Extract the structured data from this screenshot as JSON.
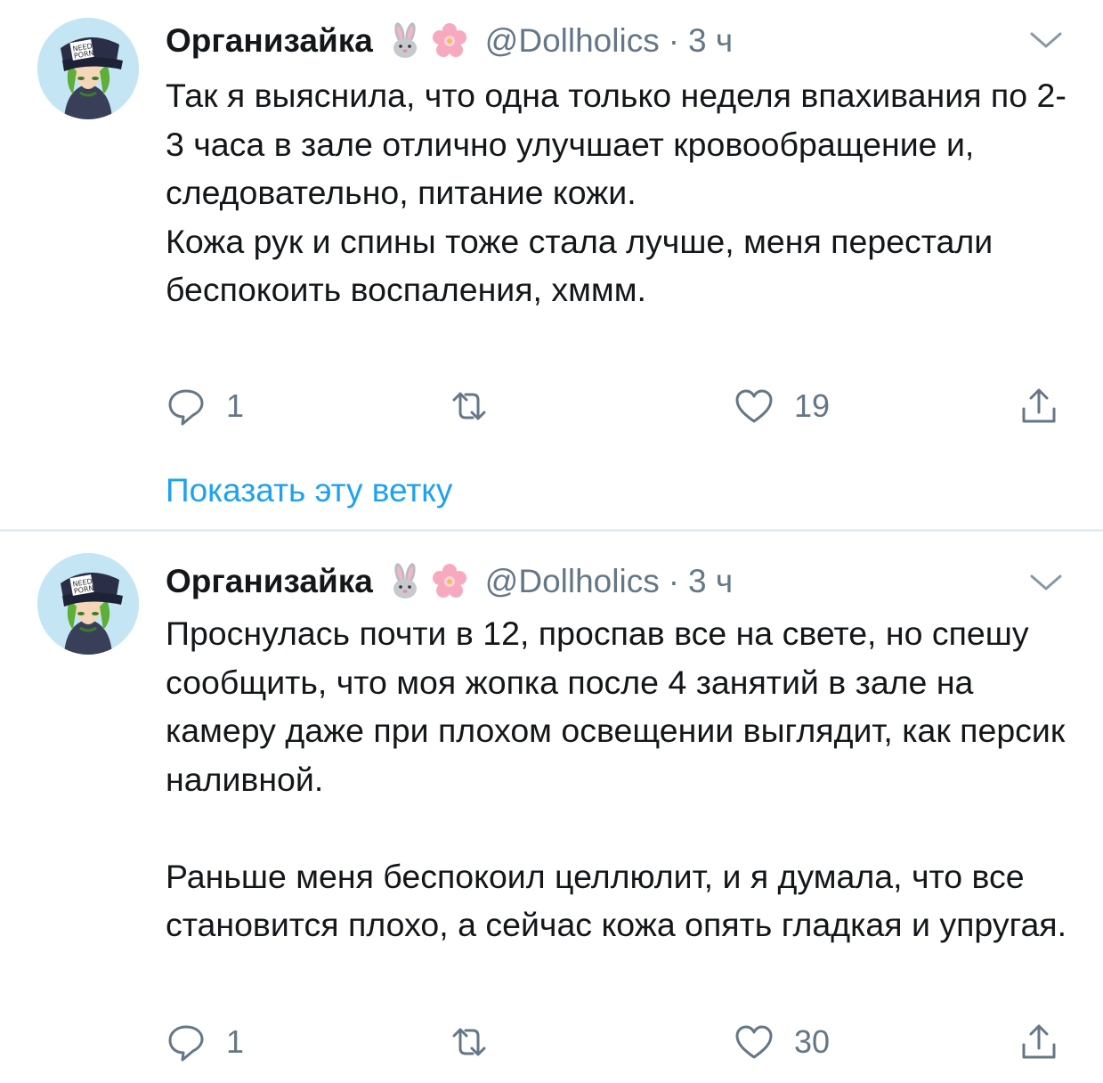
{
  "tweets": [
    {
      "author": "Организайка",
      "handle": "@Dollholics",
      "separator": "·",
      "time": "3 ч",
      "text": [
        "Так я выяснила, что одна только неделя впахивания по 2-3 часа в зале отлично улучшает кровообращение и, следовательно, питание кожи.",
        "Кожа рук и спины тоже стала лучше, меня перестали беспокоить воспаления, хммм."
      ],
      "replies": "1",
      "retweets": "",
      "likes": "19",
      "thread_link": "Показать эту ветку"
    },
    {
      "author": "Организайка",
      "handle": "@Dollholics",
      "separator": "·",
      "time": "3 ч",
      "text": [
        "Проснулась почти в 12, проспав все на свете, но спешу сообщить, что моя жопка после 4 занятий в зале на камеру даже при плохом освещении выглядит, как персик наливной.",
        "",
        "Раньше меня беспокоил целлюлит, и я думала, что все становится плохо, а сейчас кожа опять гладкая и упругая."
      ],
      "replies": "1",
      "retweets": "",
      "likes": "30"
    }
  ],
  "colors": {
    "text": "#14171a",
    "secondary": "#657786",
    "link": "#1da1f2",
    "separator": "#e6ecf0"
  },
  "icons": [
    "avatar",
    "rabbit-emoji-icon",
    "cherry-blossom-emoji-icon",
    "chevron-down-icon",
    "reply-icon",
    "retweet-icon",
    "like-icon",
    "share-icon"
  ]
}
